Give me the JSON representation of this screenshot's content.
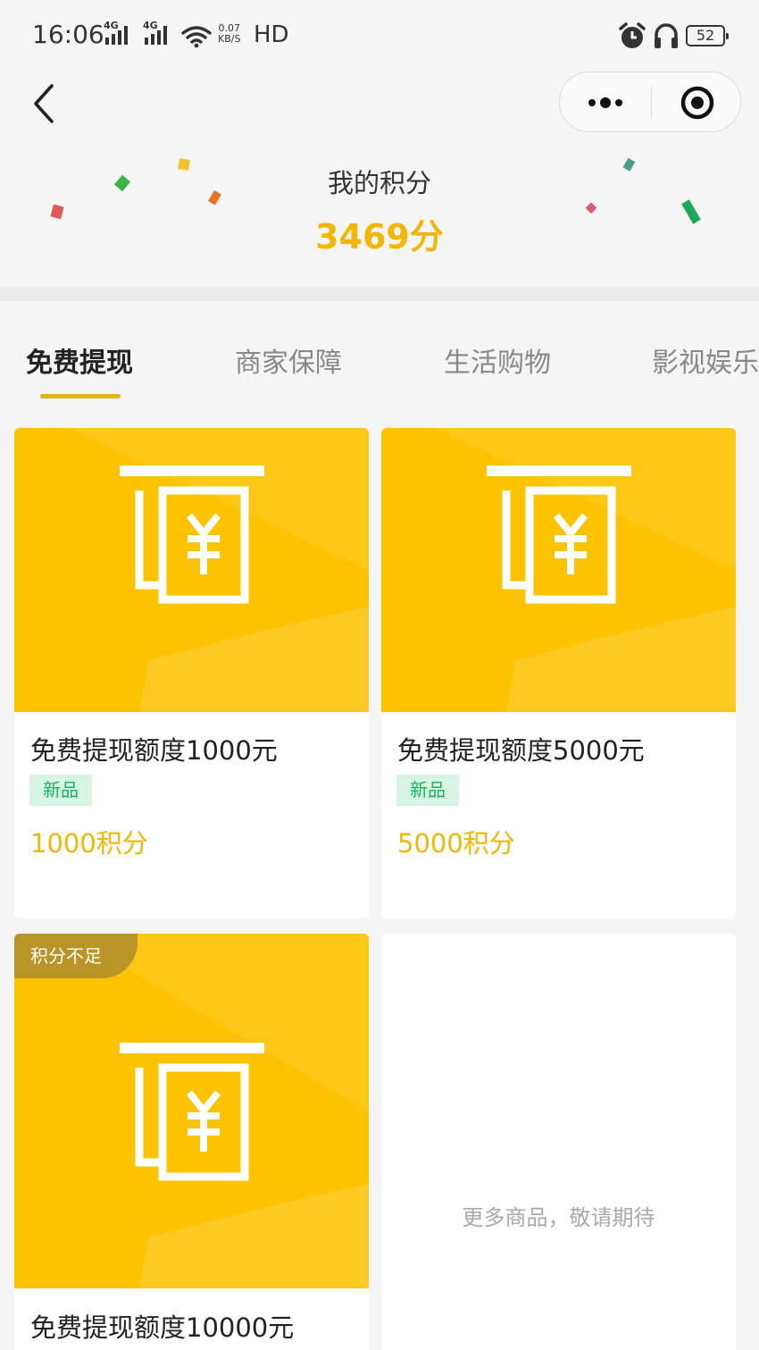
{
  "status": {
    "time": "16:06",
    "net1": "4G",
    "net2": "4G",
    "speed_value": "0.07",
    "speed_unit": "KB/S",
    "hd": "HD",
    "battery": "52"
  },
  "header": {
    "title": "我的积分",
    "points": "3469分"
  },
  "tabs": [
    {
      "label": "免费提现"
    },
    {
      "label": "商家保障"
    },
    {
      "label": "生活购物"
    },
    {
      "label": "影视娱乐"
    }
  ],
  "products": [
    {
      "title": "免费提现额度1000元",
      "badge": "新品",
      "price": "1000积分"
    },
    {
      "title": "免费提现额度5000元",
      "badge": "新品",
      "price": "5000积分"
    },
    {
      "title": "免费提现额度10000元",
      "tag": "积分不足"
    }
  ],
  "placeholder": {
    "text": "更多商品，敬请期待"
  },
  "colors": {
    "accent": "#f2b705",
    "card_bg": "#fdc200",
    "badge_green": "#17b35a",
    "tag_bg": "#b99527"
  },
  "icons": [
    "back-icon",
    "more-icon",
    "target-icon",
    "alarm-icon",
    "headphones-icon",
    "wifi-icon",
    "atm-yuan-icon"
  ]
}
